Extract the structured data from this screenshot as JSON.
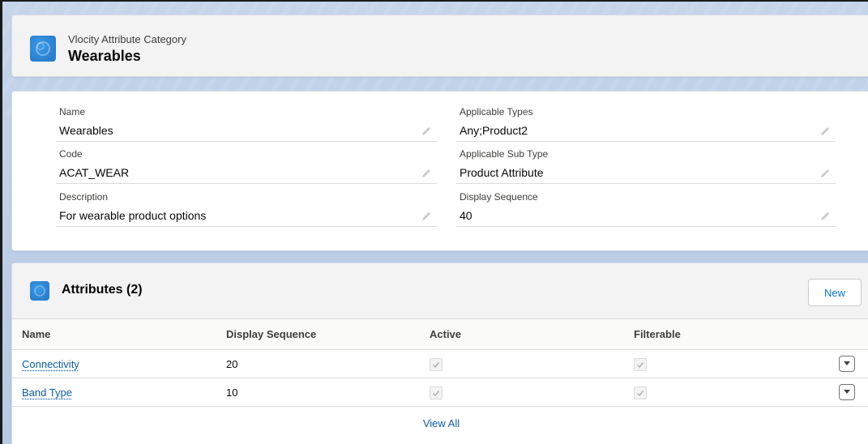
{
  "header": {
    "subtitle": "Vlocity Attribute Category",
    "title": "Wearables",
    "icon": "attribute-category-icon"
  },
  "details": {
    "left": [
      {
        "label": "Name",
        "value": "Wearables"
      },
      {
        "label": "Code",
        "value": "ACAT_WEAR"
      },
      {
        "label": "Description",
        "value": "For wearable product options"
      }
    ],
    "right": [
      {
        "label": "Applicable Types",
        "value": "Any;Product2"
      },
      {
        "label": "Applicable Sub Type",
        "value": "Product Attribute"
      },
      {
        "label": "Display Sequence",
        "value": "40"
      }
    ]
  },
  "related": {
    "title": "Attributes (2)",
    "new_label": "New",
    "columns": [
      "Name",
      "Display Sequence",
      "Active",
      "Filterable"
    ],
    "rows": [
      {
        "name": "Connectivity",
        "display_sequence": "20",
        "active": true,
        "filterable": true
      },
      {
        "name": "Band Type",
        "display_sequence": "10",
        "active": true,
        "filterable": true
      }
    ],
    "view_all": "View All"
  },
  "colors": {
    "brand": "#0176d3",
    "link": "#0b5cab",
    "icon_bg": "#2a7fd0",
    "background": "#b5c9e3"
  }
}
